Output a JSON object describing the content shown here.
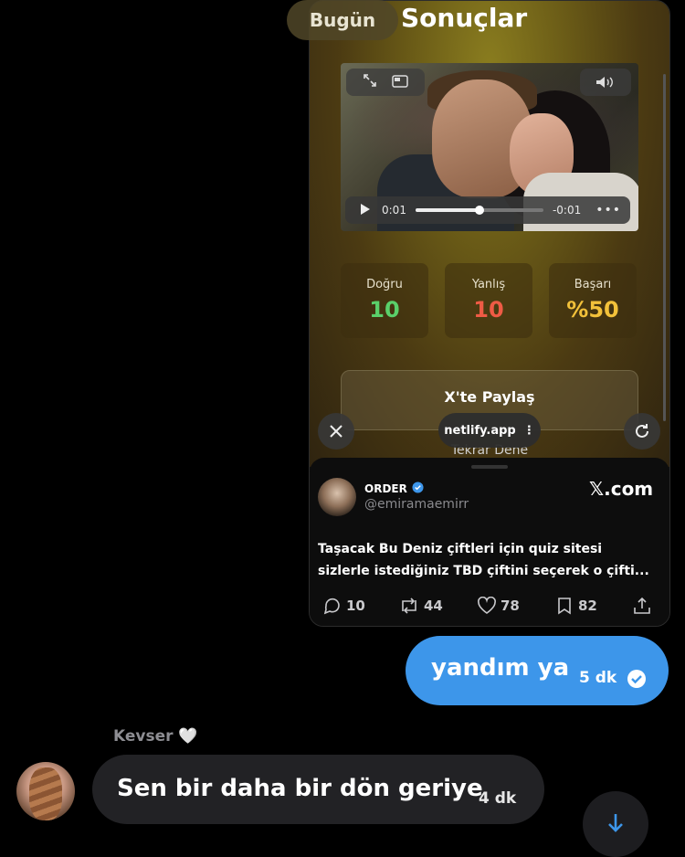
{
  "header": {
    "date_chip": "Bugün"
  },
  "shared_card": {
    "screenshot": {
      "title": "Sonuçlar",
      "video": {
        "time_elapsed": "0:01",
        "time_remaining": "-0:01",
        "progress": 0.5
      },
      "stats": [
        {
          "label": "Doğru",
          "value": "10",
          "color": "#5ad06a"
        },
        {
          "label": "Yanlış",
          "value": "10",
          "color": "#ef5b45"
        },
        {
          "label": "Başarı",
          "value": "%50",
          "color": "#f2c13a"
        }
      ],
      "share_button": "X'te Paylaş",
      "retry_button": "Tekrar Dene",
      "url": "netlify.app"
    },
    "tweet": {
      "author_name": "ORDER",
      "handle": "@emiramaemirr",
      "source": "𝕏.com",
      "text_line1": "Taşacak Bu Deniz çiftleri için quiz sitesi",
      "text_line2": "sizlerle istediğiniz TBD çiftini seçerek o çifti...",
      "replies": "10",
      "retweets": "44",
      "likes": "78",
      "bookmarks": "82"
    }
  },
  "outgoing_message": {
    "text": "yandım ya",
    "time": "5 dk"
  },
  "incoming_message": {
    "sender": "Kevser 🤍",
    "text": "Sen bir daha bir dön geriye",
    "time": "4 dk"
  },
  "colors": {
    "outgoing_bubble": "#3d96ea",
    "incoming_bubble": "#222225",
    "background": "#000000"
  }
}
